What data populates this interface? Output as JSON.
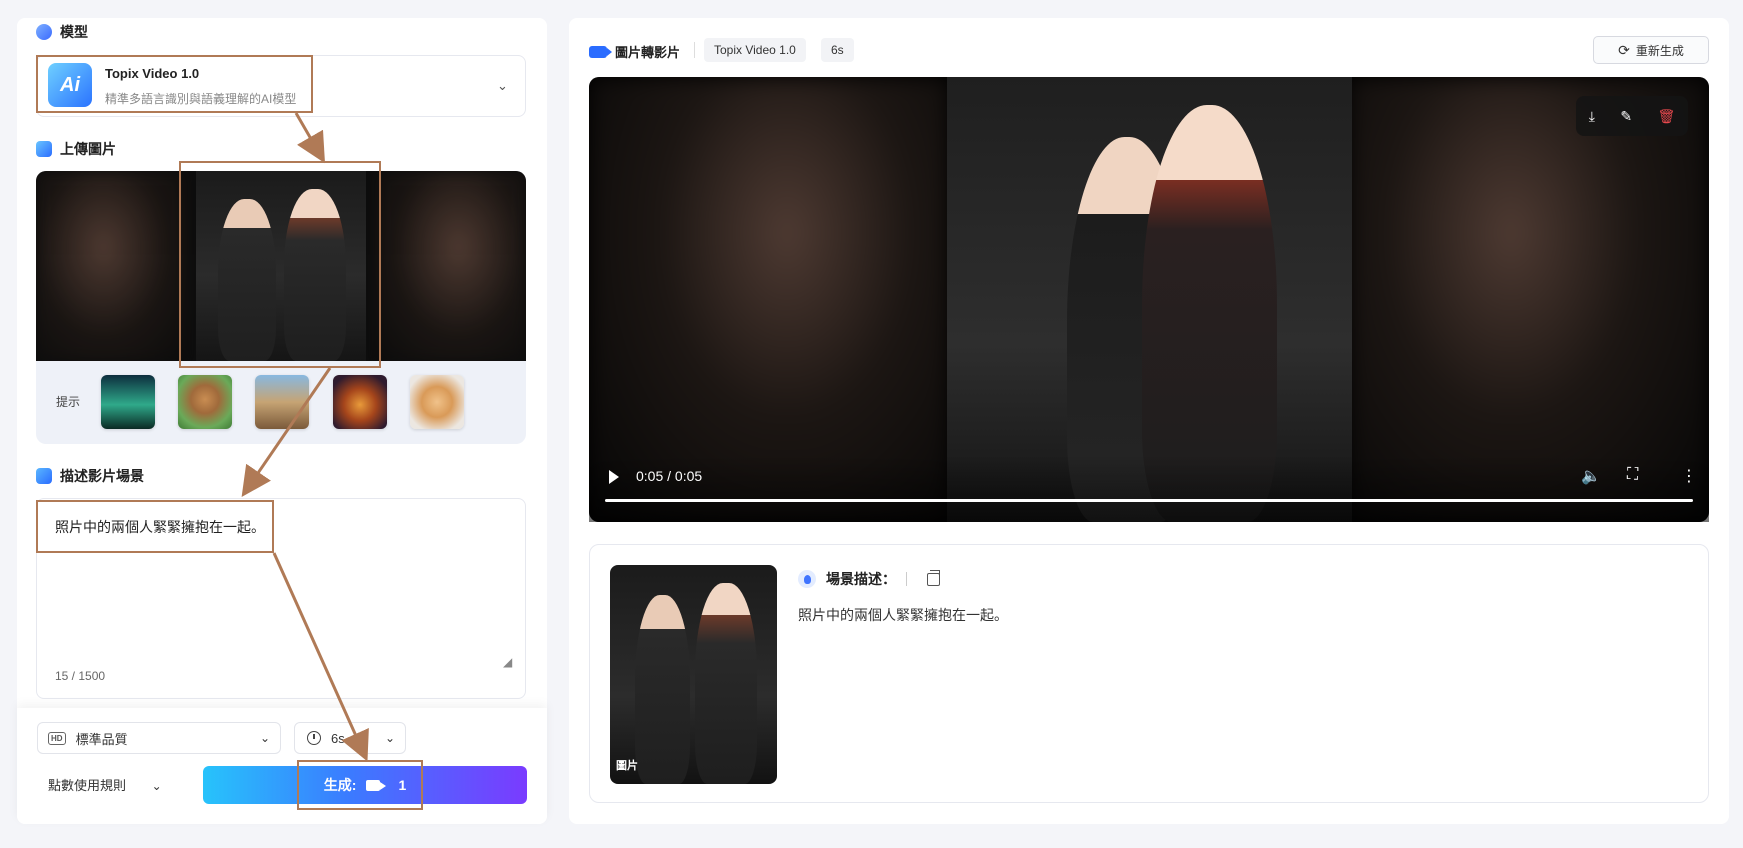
{
  "left": {
    "model_section_title": "模型",
    "model": {
      "name": "Topix Video 1.0",
      "desc": "精準多語言識別與語義理解的AI模型",
      "logo_text": "Ai"
    },
    "upload_section_title": "上傳圖片",
    "hint_label": "提示",
    "hint_thumbs": [
      "aurora-thumbnail",
      "bear-thumbnail",
      "cyclist-thumbnail",
      "perfume-thumbnail",
      "cat-thumbnail"
    ],
    "scene_section_title": "描述影片場景",
    "scene_text": "照片中的兩個人緊緊擁抱在一起。",
    "char_count": "15 / 1500",
    "quality_icon": "HD",
    "quality_value": "標準品質",
    "duration_value": "6s",
    "rules_label": "點數使用規則",
    "generate_label": "生成:",
    "generate_cost": "1"
  },
  "right": {
    "title": "圖片轉影片",
    "model_tag": "Topix Video 1.0",
    "duration_tag": "6s",
    "regenerate_label": "重新生成",
    "video": {
      "time": "0:05 / 0:05",
      "progress": 1.0
    },
    "desc_title": "場景描述：",
    "desc_text": "照片中的兩個人緊緊擁抱在一起。",
    "thumb_label": "圖片"
  },
  "colors": {
    "accent": "#2a6cff",
    "annotation": "#b07a56",
    "delete": "#e5484d"
  }
}
